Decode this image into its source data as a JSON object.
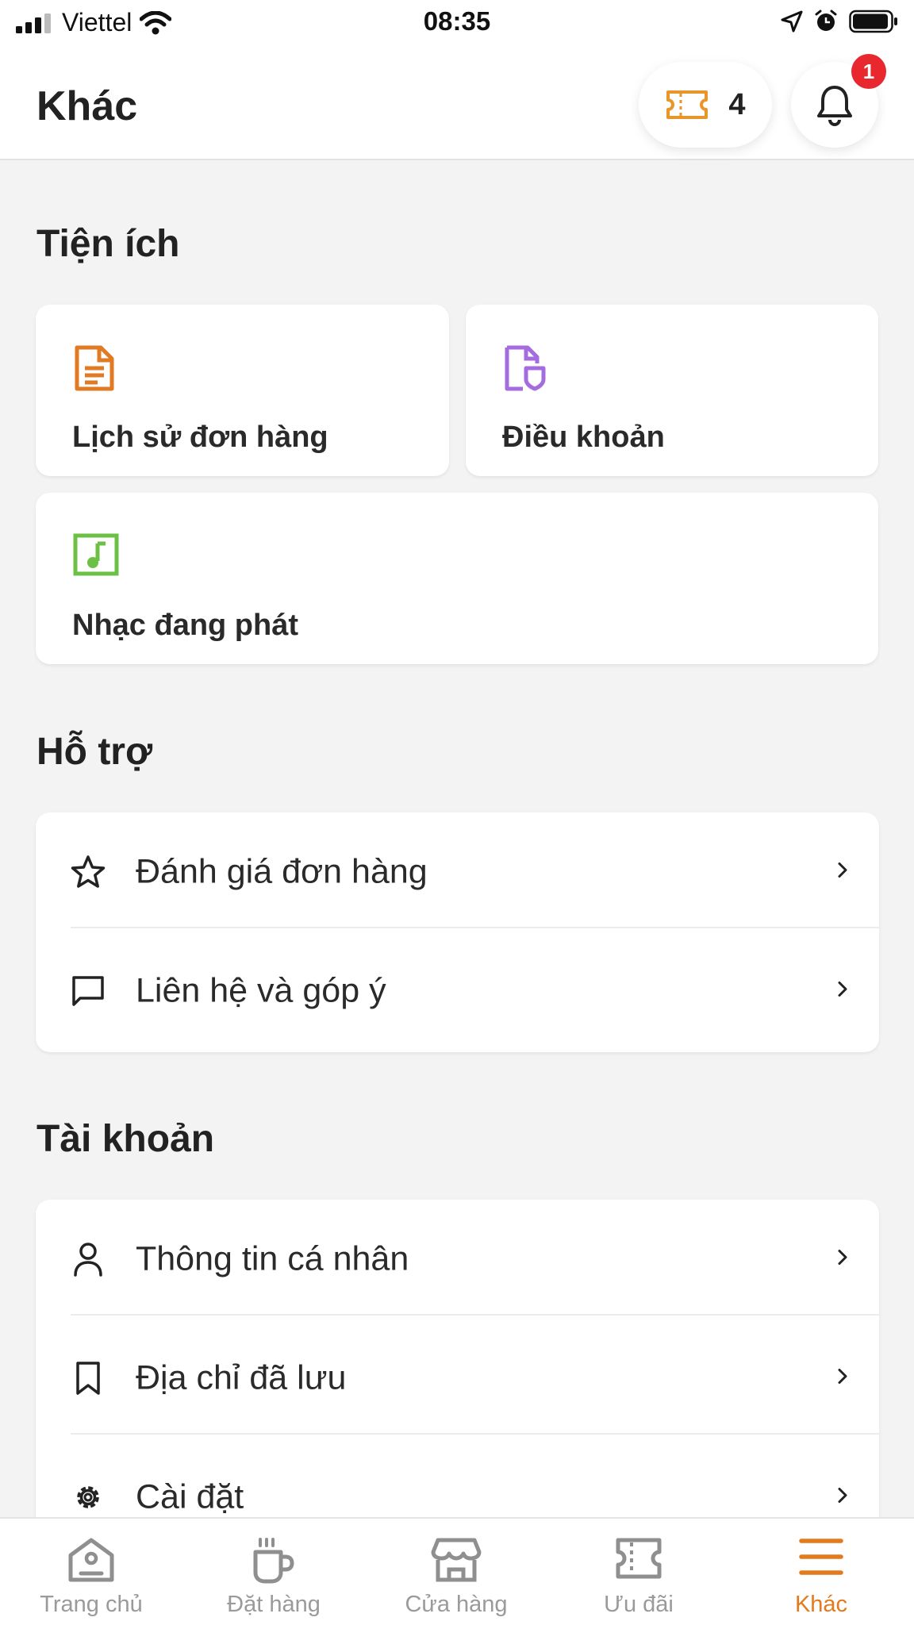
{
  "status_bar": {
    "carrier": "Viettel",
    "time": "08:35"
  },
  "header": {
    "title": "Khác",
    "voucher_count": "4",
    "notification_count": "1"
  },
  "utilities": {
    "title": "Tiện ích",
    "tiles": [
      {
        "label": "Lịch sử đơn hàng",
        "icon": "order-history-icon"
      },
      {
        "label": "Điều khoản",
        "icon": "terms-icon"
      },
      {
        "label": "Nhạc đang phát",
        "icon": "music-icon"
      }
    ]
  },
  "support": {
    "title": "Hỗ trợ",
    "items": [
      {
        "label": "Đánh giá đơn hàng",
        "icon": "star-icon"
      },
      {
        "label": "Liên hệ và góp ý",
        "icon": "message-icon"
      }
    ]
  },
  "account": {
    "title": "Tài khoản",
    "items": [
      {
        "label": "Thông tin cá nhân",
        "icon": "user-icon"
      },
      {
        "label": "Địa chỉ đã lưu",
        "icon": "bookmark-icon"
      },
      {
        "label": "Cài đặt",
        "icon": "settings-icon"
      }
    ]
  },
  "bottom_nav": {
    "items": [
      {
        "label": "Trang chủ",
        "icon": "home-icon"
      },
      {
        "label": "Đặt hàng",
        "icon": "coffee-cup-icon"
      },
      {
        "label": "Cửa hàng",
        "icon": "store-icon"
      },
      {
        "label": "Ưu đãi",
        "icon": "voucher-icon"
      },
      {
        "label": "Khác",
        "icon": "menu-icon"
      }
    ],
    "active": "Khác"
  },
  "colors": {
    "accent": "#e37a1d",
    "badge": "#e8272f",
    "order_icon": "#e07a23",
    "terms_icon": "#a56ce0",
    "music_icon": "#6cc043",
    "background": "#f3f3f3"
  }
}
